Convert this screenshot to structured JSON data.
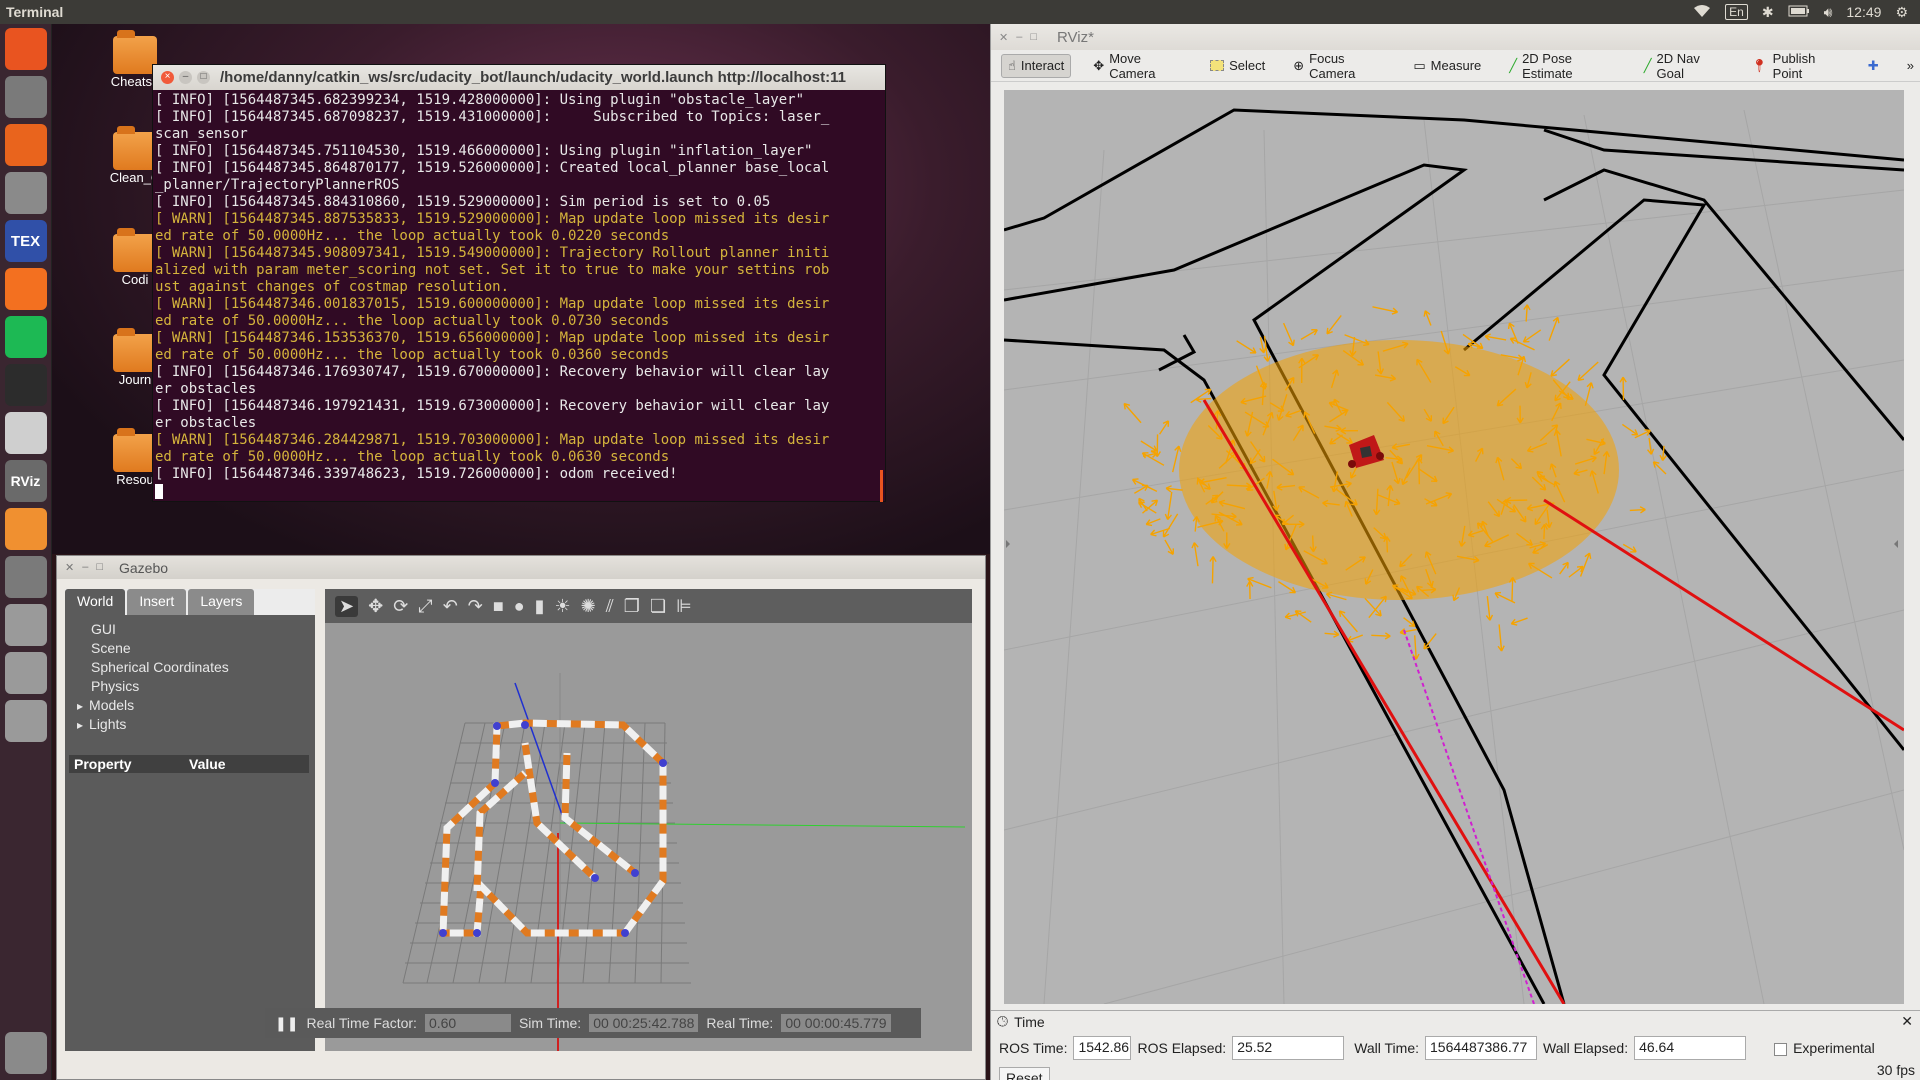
{
  "top_panel": {
    "app_title": "Terminal",
    "keyboard": "En",
    "clock": "12:49"
  },
  "launcher": {
    "items": [
      {
        "icon": "ubuntu-dash-icon",
        "color": "#e95420"
      },
      {
        "icon": "files-icon",
        "color": "#7a7a7a"
      },
      {
        "icon": "software-center-icon",
        "color": "#e9641d"
      },
      {
        "icon": "system-settings-icon",
        "color": "#8a8a8a"
      },
      {
        "icon": "texmaker-icon",
        "color": "#3050a8",
        "label": "TEX"
      },
      {
        "icon": "firefox-icon",
        "color": "#f37020"
      },
      {
        "icon": "spotify-icon",
        "color": "#1db954"
      },
      {
        "icon": "terminal-icon",
        "color": "#2c2c2c"
      },
      {
        "icon": "text-editor-icon",
        "color": "#cfcfcf"
      },
      {
        "icon": "rviz-icon",
        "color": "#6a6a6a",
        "label": "RViz"
      },
      {
        "icon": "gazebo-icon",
        "color": "#f09030"
      },
      {
        "icon": "workspace-icon",
        "color": "#7a7a7a"
      },
      {
        "icon": "drive-icon",
        "color": "#9a9a9a"
      },
      {
        "icon": "drive-icon",
        "color": "#9a9a9a"
      },
      {
        "icon": "drive-icon",
        "color": "#9a9a9a"
      },
      {
        "icon": "trash-icon",
        "color": "#8a8a8a"
      }
    ]
  },
  "desktop": {
    "icons": [
      "Cheatsh",
      "Clean_C",
      "Codi",
      "Journ",
      "Resou"
    ]
  },
  "terminal": {
    "title": "/home/danny/catkin_ws/src/udacity_bot/launch/udacity_world.launch http://localhost:11",
    "lines": [
      {
        "level": "info",
        "text": "[ INFO] [1564487345.682399234, 1519.428000000]: Using plugin \"obstacle_layer\""
      },
      {
        "level": "info",
        "text": "[ INFO] [1564487345.687098237, 1519.431000000]:     Subscribed to Topics: laser_"
      },
      {
        "level": "info",
        "text": "scan_sensor"
      },
      {
        "level": "info",
        "text": "[ INFO] [1564487345.751104530, 1519.466000000]: Using plugin \"inflation_layer\""
      },
      {
        "level": "info",
        "text": "[ INFO] [1564487345.864870177, 1519.526000000]: Created local_planner base_local"
      },
      {
        "level": "info",
        "text": "_planner/TrajectoryPlannerROS"
      },
      {
        "level": "info",
        "text": "[ INFO] [1564487345.884310860, 1519.529000000]: Sim period is set to 0.05"
      },
      {
        "level": "warn",
        "text": "[ WARN] [1564487345.887535833, 1519.529000000]: Map update loop missed its desir"
      },
      {
        "level": "warn",
        "text": "ed rate of 50.0000Hz... the loop actually took 0.0220 seconds"
      },
      {
        "level": "warn",
        "text": "[ WARN] [1564487345.908097341, 1519.549000000]: Trajectory Rollout planner initi"
      },
      {
        "level": "warn",
        "text": "alized with param meter_scoring not set. Set it to true to make your settins rob"
      },
      {
        "level": "warn",
        "text": "ust against changes of costmap resolution."
      },
      {
        "level": "warn",
        "text": "[ WARN] [1564487346.001837015, 1519.600000000]: Map update loop missed its desir"
      },
      {
        "level": "warn",
        "text": "ed rate of 50.0000Hz... the loop actually took 0.0730 seconds"
      },
      {
        "level": "warn",
        "text": "[ WARN] [1564487346.153536370, 1519.656000000]: Map update loop missed its desir"
      },
      {
        "level": "warn",
        "text": "ed rate of 50.0000Hz... the loop actually took 0.0360 seconds"
      },
      {
        "level": "info",
        "text": "[ INFO] [1564487346.176930747, 1519.670000000]: Recovery behavior will clear lay"
      },
      {
        "level": "info",
        "text": "er obstacles"
      },
      {
        "level": "info",
        "text": "[ INFO] [1564487346.197921431, 1519.673000000]: Recovery behavior will clear lay"
      },
      {
        "level": "info",
        "text": "er obstacles"
      },
      {
        "level": "warn",
        "text": "[ WARN] [1564487346.284429871, 1519.703000000]: Map update loop missed its desir"
      },
      {
        "level": "warn",
        "text": "ed rate of 50.0000Hz... the loop actually took 0.0630 seconds"
      },
      {
        "level": "info",
        "text": "[ INFO] [1564487346.339748623, 1519.726000000]: odom received!"
      }
    ]
  },
  "gazebo": {
    "title": "Gazebo",
    "tabs": [
      "World",
      "Insert",
      "Layers"
    ],
    "tree": [
      {
        "label": "GUI",
        "expandable": false
      },
      {
        "label": "Scene",
        "expandable": false
      },
      {
        "label": "Spherical Coordinates",
        "expandable": false
      },
      {
        "label": "Physics",
        "expandable": false
      },
      {
        "label": "Models",
        "expandable": true
      },
      {
        "label": "Lights",
        "expandable": true
      }
    ],
    "property_header": {
      "property": "Property",
      "value": "Value"
    },
    "status": {
      "pause_label": "❚❚",
      "rtf_label": "Real Time Factor:",
      "rtf_value": "0.60",
      "sim_time_label": "Sim Time:",
      "sim_time_value": "00 00:25:42.788",
      "real_time_label": "Real Time:",
      "real_time_value": "00 00:00:45.779"
    }
  },
  "rviz": {
    "title": "RViz*",
    "tools": [
      {
        "label": "Interact",
        "icon": "hand-icon",
        "active": true
      },
      {
        "label": "Move Camera",
        "icon": "move-camera-icon",
        "active": false
      },
      {
        "label": "Select",
        "icon": "select-icon",
        "active": false
      },
      {
        "label": "Focus Camera",
        "icon": "focus-camera-icon",
        "active": false
      },
      {
        "label": "Measure",
        "icon": "measure-icon",
        "active": false
      },
      {
        "label": "2D Pose Estimate",
        "icon": "pose-estimate-icon",
        "active": false
      },
      {
        "label": "2D Nav Goal",
        "icon": "nav-goal-icon",
        "active": false
      },
      {
        "label": "Publish Point",
        "icon": "publish-point-icon",
        "active": false
      }
    ],
    "time_panel": {
      "title": "Time",
      "ros_time_label": "ROS Time:",
      "ros_time": "1542.86",
      "ros_elapsed_label": "ROS Elapsed:",
      "ros_elapsed": "25.52",
      "wall_time_label": "Wall Time:",
      "wall_time": "1564487386.77",
      "wall_elapsed_label": "Wall Elapsed:",
      "wall_elapsed": "46.64",
      "experimental_label": "Experimental",
      "reset_label": "Reset",
      "fps": "30 fps"
    },
    "colors": {
      "particles": "#f5a300",
      "laser": "#e01010",
      "path": "#d020d0",
      "robot": "#c01818"
    }
  }
}
